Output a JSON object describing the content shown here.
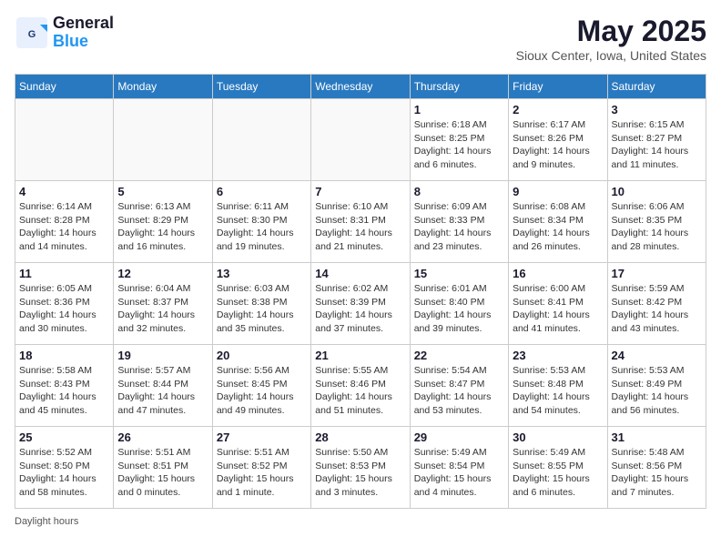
{
  "header": {
    "logo_general": "General",
    "logo_blue": "Blue",
    "month_title": "May 2025",
    "location": "Sioux Center, Iowa, United States"
  },
  "days_of_week": [
    "Sunday",
    "Monday",
    "Tuesday",
    "Wednesday",
    "Thursday",
    "Friday",
    "Saturday"
  ],
  "footer": {
    "note": "Daylight hours"
  },
  "weeks": [
    [
      {
        "day": "",
        "info": ""
      },
      {
        "day": "",
        "info": ""
      },
      {
        "day": "",
        "info": ""
      },
      {
        "day": "",
        "info": ""
      },
      {
        "day": "1",
        "info": "Sunrise: 6:18 AM\nSunset: 8:25 PM\nDaylight: 14 hours\nand 6 minutes."
      },
      {
        "day": "2",
        "info": "Sunrise: 6:17 AM\nSunset: 8:26 PM\nDaylight: 14 hours\nand 9 minutes."
      },
      {
        "day": "3",
        "info": "Sunrise: 6:15 AM\nSunset: 8:27 PM\nDaylight: 14 hours\nand 11 minutes."
      }
    ],
    [
      {
        "day": "4",
        "info": "Sunrise: 6:14 AM\nSunset: 8:28 PM\nDaylight: 14 hours\nand 14 minutes."
      },
      {
        "day": "5",
        "info": "Sunrise: 6:13 AM\nSunset: 8:29 PM\nDaylight: 14 hours\nand 16 minutes."
      },
      {
        "day": "6",
        "info": "Sunrise: 6:11 AM\nSunset: 8:30 PM\nDaylight: 14 hours\nand 19 minutes."
      },
      {
        "day": "7",
        "info": "Sunrise: 6:10 AM\nSunset: 8:31 PM\nDaylight: 14 hours\nand 21 minutes."
      },
      {
        "day": "8",
        "info": "Sunrise: 6:09 AM\nSunset: 8:33 PM\nDaylight: 14 hours\nand 23 minutes."
      },
      {
        "day": "9",
        "info": "Sunrise: 6:08 AM\nSunset: 8:34 PM\nDaylight: 14 hours\nand 26 minutes."
      },
      {
        "day": "10",
        "info": "Sunrise: 6:06 AM\nSunset: 8:35 PM\nDaylight: 14 hours\nand 28 minutes."
      }
    ],
    [
      {
        "day": "11",
        "info": "Sunrise: 6:05 AM\nSunset: 8:36 PM\nDaylight: 14 hours\nand 30 minutes."
      },
      {
        "day": "12",
        "info": "Sunrise: 6:04 AM\nSunset: 8:37 PM\nDaylight: 14 hours\nand 32 minutes."
      },
      {
        "day": "13",
        "info": "Sunrise: 6:03 AM\nSunset: 8:38 PM\nDaylight: 14 hours\nand 35 minutes."
      },
      {
        "day": "14",
        "info": "Sunrise: 6:02 AM\nSunset: 8:39 PM\nDaylight: 14 hours\nand 37 minutes."
      },
      {
        "day": "15",
        "info": "Sunrise: 6:01 AM\nSunset: 8:40 PM\nDaylight: 14 hours\nand 39 minutes."
      },
      {
        "day": "16",
        "info": "Sunrise: 6:00 AM\nSunset: 8:41 PM\nDaylight: 14 hours\nand 41 minutes."
      },
      {
        "day": "17",
        "info": "Sunrise: 5:59 AM\nSunset: 8:42 PM\nDaylight: 14 hours\nand 43 minutes."
      }
    ],
    [
      {
        "day": "18",
        "info": "Sunrise: 5:58 AM\nSunset: 8:43 PM\nDaylight: 14 hours\nand 45 minutes."
      },
      {
        "day": "19",
        "info": "Sunrise: 5:57 AM\nSunset: 8:44 PM\nDaylight: 14 hours\nand 47 minutes."
      },
      {
        "day": "20",
        "info": "Sunrise: 5:56 AM\nSunset: 8:45 PM\nDaylight: 14 hours\nand 49 minutes."
      },
      {
        "day": "21",
        "info": "Sunrise: 5:55 AM\nSunset: 8:46 PM\nDaylight: 14 hours\nand 51 minutes."
      },
      {
        "day": "22",
        "info": "Sunrise: 5:54 AM\nSunset: 8:47 PM\nDaylight: 14 hours\nand 53 minutes."
      },
      {
        "day": "23",
        "info": "Sunrise: 5:53 AM\nSunset: 8:48 PM\nDaylight: 14 hours\nand 54 minutes."
      },
      {
        "day": "24",
        "info": "Sunrise: 5:53 AM\nSunset: 8:49 PM\nDaylight: 14 hours\nand 56 minutes."
      }
    ],
    [
      {
        "day": "25",
        "info": "Sunrise: 5:52 AM\nSunset: 8:50 PM\nDaylight: 14 hours\nand 58 minutes."
      },
      {
        "day": "26",
        "info": "Sunrise: 5:51 AM\nSunset: 8:51 PM\nDaylight: 15 hours\nand 0 minutes."
      },
      {
        "day": "27",
        "info": "Sunrise: 5:51 AM\nSunset: 8:52 PM\nDaylight: 15 hours\nand 1 minute."
      },
      {
        "day": "28",
        "info": "Sunrise: 5:50 AM\nSunset: 8:53 PM\nDaylight: 15 hours\nand 3 minutes."
      },
      {
        "day": "29",
        "info": "Sunrise: 5:49 AM\nSunset: 8:54 PM\nDaylight: 15 hours\nand 4 minutes."
      },
      {
        "day": "30",
        "info": "Sunrise: 5:49 AM\nSunset: 8:55 PM\nDaylight: 15 hours\nand 6 minutes."
      },
      {
        "day": "31",
        "info": "Sunrise: 5:48 AM\nSunset: 8:56 PM\nDaylight: 15 hours\nand 7 minutes."
      }
    ]
  ]
}
